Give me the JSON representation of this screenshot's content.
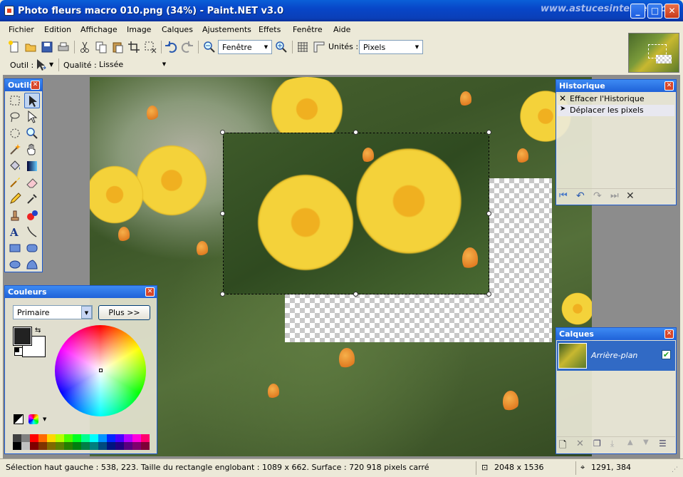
{
  "window": {
    "title": "Photo fleurs macro 010.png (34%) - Paint.NET v3.0",
    "watermark": "www.astucesinternet.com",
    "buttons": {
      "minimize": "_",
      "maximize": "□",
      "close": "✕"
    }
  },
  "menu": [
    "Fichier",
    "Edition",
    "Affichage",
    "Image",
    "Calques",
    "Ajustements",
    "Effets",
    "Fenêtre",
    "Aide"
  ],
  "toolbar": {
    "zoom_value": "Fenêtre",
    "units_label": "Unités :",
    "units_value": "Pixels",
    "tool_label": "Outil :",
    "quality_label": "Qualité :",
    "quality_value": "Lissée"
  },
  "panels": {
    "tools": {
      "title": "Outils"
    },
    "colors": {
      "title": "Couleurs",
      "mode_value": "Primaire",
      "more_button": "Plus >>",
      "primary_color": "#222222",
      "secondary_color": "#ffffff",
      "palette_row1": [
        "#404040",
        "#808080",
        "#ff0000",
        "#ff6a00",
        "#ffd800",
        "#b6ff00",
        "#4cff00",
        "#00ff21",
        "#00ff90",
        "#00ffff",
        "#0094ff",
        "#0026ff",
        "#4800ff",
        "#b200ff",
        "#ff00dc",
        "#ff006e"
      ],
      "palette_row2": [
        "#000000",
        "#c0c0c0",
        "#7f0000",
        "#7f3300",
        "#7f6a00",
        "#5b7f00",
        "#267f00",
        "#007f0e",
        "#007f46",
        "#007f7f",
        "#004a7f",
        "#00137f",
        "#21007f",
        "#57007f",
        "#7f006e",
        "#7f0037"
      ]
    },
    "history": {
      "title": "Historique",
      "items": [
        "Effacer l'Historique",
        "Déplacer les pixels"
      ]
    },
    "layers": {
      "title": "Calques",
      "items": [
        {
          "name": "Arrière-plan",
          "visible": true
        }
      ]
    }
  },
  "status": {
    "selection_info": "Sélection haut gauche : 538, 223. Taille du rectangle englobant : 1089 x 662. Surface : 720 918 pixels carré",
    "image_size": "2048 x 1536",
    "cursor_pos": "1291, 384"
  }
}
